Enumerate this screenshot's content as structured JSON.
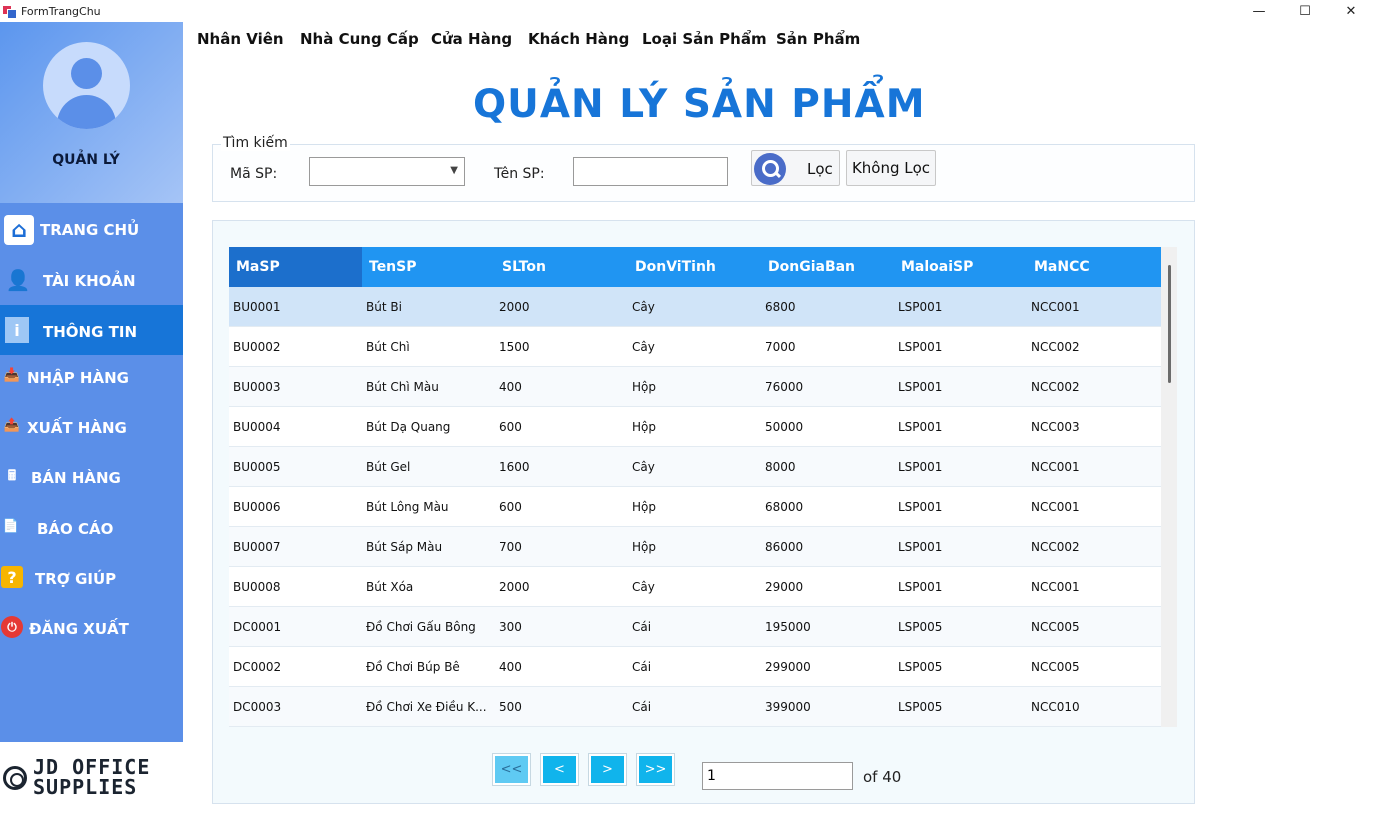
{
  "window": {
    "title": "FormTrangChu",
    "min": "—",
    "max": "☐",
    "close": "✕"
  },
  "sidebar": {
    "role": "QUẢN LÝ",
    "items": [
      {
        "label": "TRANG CHỦ",
        "icon": "home-icon",
        "glyph": "⌂"
      },
      {
        "label": "TÀI KHOẢN",
        "icon": "user-icon",
        "glyph": "👤"
      },
      {
        "label": "THÔNG TIN",
        "icon": "info-icon",
        "glyph": "i"
      },
      {
        "label": "NHẬP HÀNG",
        "icon": "import-icon",
        "glyph": "📥"
      },
      {
        "label": "XUẤT HÀNG",
        "icon": "export-icon",
        "glyph": "📤"
      },
      {
        "label": "BÁN HÀNG",
        "icon": "cash-register-icon",
        "glyph": "🖩"
      },
      {
        "label": "BÁO CÁO",
        "icon": "report-icon",
        "glyph": "📄"
      },
      {
        "label": "TRỢ GIÚP",
        "icon": "help-icon",
        "glyph": "?"
      },
      {
        "label": "ĐĂNG XUẤT",
        "icon": "logout-icon",
        "glyph": "⏻"
      }
    ],
    "logo_line1": "JD OFFICE",
    "logo_line2": "SUPPLIES"
  },
  "menubar": [
    "Nhân Viên",
    "Nhà Cung Cấp",
    "Cửa Hàng",
    "Khách Hàng",
    "Loại Sản Phẩm",
    "Sản Phẩm"
  ],
  "page_title": "QUẢN LÝ SẢN PHẨM",
  "search": {
    "legend": "Tìm kiếm",
    "masp_label": "Mã SP:",
    "tensp_label": "Tên SP:",
    "masp_value": "",
    "tensp_value": "",
    "filter_button": "Lọc",
    "no_filter_button": "Không Lọc"
  },
  "grid": {
    "columns": [
      "MaSP",
      "TenSP",
      "SLTon",
      "DonViTinh",
      "DonGiaBan",
      "MaloaiSP",
      "MaNCC"
    ],
    "rows": [
      [
        "BU0001",
        "Bút Bi",
        "2000",
        "Cây",
        "6800",
        "LSP001",
        "NCC001"
      ],
      [
        "BU0002",
        "Bút Chì",
        "1500",
        "Cây",
        "7000",
        "LSP001",
        "NCC002"
      ],
      [
        "BU0003",
        "Bút Chì Màu",
        "400",
        "Hộp",
        "76000",
        "LSP001",
        "NCC002"
      ],
      [
        "BU0004",
        "Bút Dạ Quang",
        "600",
        "Hộp",
        "50000",
        "LSP001",
        "NCC003"
      ],
      [
        "BU0005",
        "Bút Gel",
        "1600",
        "Cây",
        "8000",
        "LSP001",
        "NCC001"
      ],
      [
        "BU0006",
        "Bút Lông Màu",
        "600",
        "Hộp",
        "68000",
        "LSP001",
        "NCC001"
      ],
      [
        "BU0007",
        "Bút Sáp Màu",
        "700",
        "Hộp",
        "86000",
        "LSP001",
        "NCC002"
      ],
      [
        "BU0008",
        "Bút Xóa",
        "2000",
        "Cây",
        "29000",
        "LSP001",
        "NCC001"
      ],
      [
        "DC0001",
        "Đồ Chơi Gấu Bông",
        "300",
        "Cái",
        "195000",
        "LSP005",
        "NCC005"
      ],
      [
        "DC0002",
        "Đồ Chơi Búp Bê",
        "400",
        "Cái",
        "299000",
        "LSP005",
        "NCC005"
      ],
      [
        "DC0003",
        "Đồ Chơi Xe Điều K...",
        "500",
        "Cái",
        "399000",
        "LSP005",
        "NCC010"
      ]
    ]
  },
  "pager": {
    "first": "<<",
    "prev": "<",
    "next": ">",
    "last": ">>",
    "current": "1",
    "of_text": "of 40"
  },
  "colors": {
    "accent": "#1775d8",
    "header": "#2095f2",
    "sidebar": "#5b8fe8",
    "pager": "#10b4ec"
  }
}
